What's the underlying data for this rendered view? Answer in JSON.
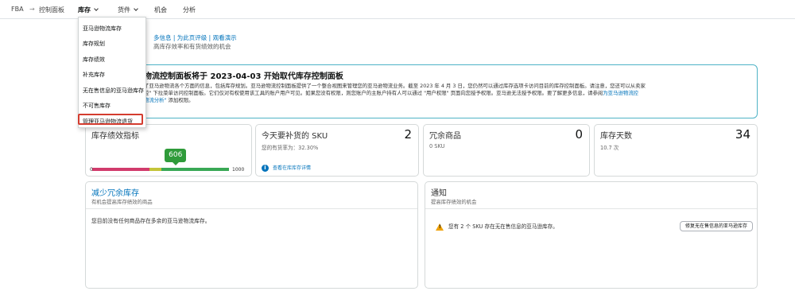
{
  "nav": {
    "breadcrumb_root": "FBA",
    "breadcrumb_sep": "→",
    "breadcrumb_current": "控制面板",
    "tabs": [
      {
        "label": "库存",
        "active": true
      },
      {
        "label": "货件"
      },
      {
        "label": "机会"
      },
      {
        "label": "分析"
      }
    ]
  },
  "dropdown": {
    "items": [
      "亚马逊物流库存",
      "库存规划",
      "库存绩效",
      "补充库存",
      "无在售信息的亚马逊库存",
      "不可售库存",
      "管理亚马逊物流退货"
    ],
    "highlighted_index": 6,
    "highlight_color": "#d43c2f"
  },
  "header": {
    "links": "多信息 | 为此页评级 | 观看演示",
    "description": "高库存效率和有货绩效的机会"
  },
  "banner": {
    "title": "物流控制面板将于 2023-04-03 开始取代库存控制面板",
    "body_1": "了亚马逊物流各个方面的信息，包括库存规划。亚马逊物流控制面板提供了一个整合视图来管理您的亚马逊物流业务。截至 2023 年 4 月 3 日，您仍然可以通过库存选项卡访问目前的库存控制面板。请注意，您还可以从卖家",
    "body_2": "控\" 下拉菜单访问控制面板。它们仅对有权使用该工具的账户用户可见。如果您没有权限，则您账户的主账户持有人可以通过 \"用户权限\" 页面向您授予权限。亚马逊无法授予权限。要了解更多信息，请参阅",
    "body_link": "为亚马逊物流控",
    "body_3_link": "物流分析\"",
    "body_3": " 添加权限。",
    "border_color": "#4fb3c6"
  },
  "metrics": {
    "ipi": {
      "title": "库存绩效指标",
      "value": "606",
      "min": "0",
      "max": "1000",
      "ratio": 0.606
    },
    "restock": {
      "title": "今天要补货的 SKU",
      "value": "2",
      "sub": "您的有货率为：32.30%",
      "link": "查看在库库存详情"
    },
    "excess": {
      "title": "冗余商品",
      "value": "0",
      "sub": "0 SKU"
    },
    "days": {
      "title": "库存天数",
      "value": "34",
      "sub": "10.7 次"
    }
  },
  "reduce": {
    "title": "减少冗余库存",
    "desc": "有机会提高库存绩效的商品",
    "body": "您目前没有任何商品存在多余的亚马逊物流库存。"
  },
  "notice": {
    "title": "通知",
    "desc": "提高库存绩效的机会",
    "message": "您有 2 个 SKU 存在无在售信息的亚马逊库存。",
    "button": "修复无在售信息的亚马逊库存"
  },
  "colors": {
    "accent": "#0073bb",
    "gauge_red": "#d13b6c",
    "gauge_yellow": "#c4c439",
    "gauge_green": "#39a855",
    "warning": "#f0a30a"
  }
}
